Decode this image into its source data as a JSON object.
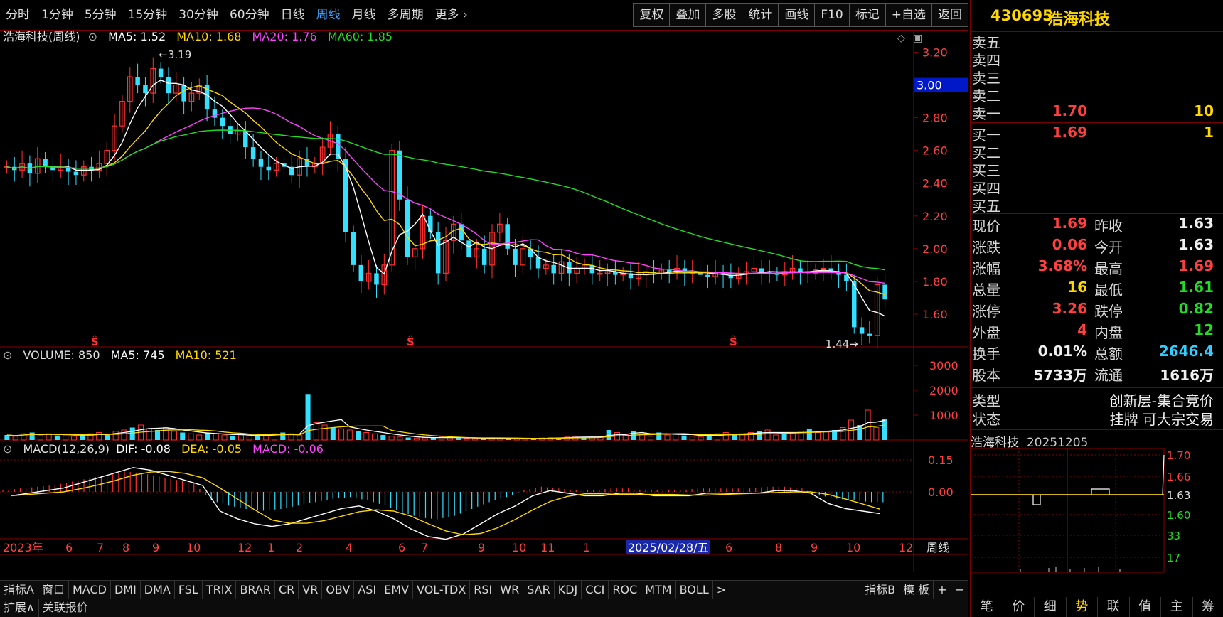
{
  "top_tabs": [
    "分时",
    "1分钟",
    "5分钟",
    "15分钟",
    "30分钟",
    "60分钟",
    "日线",
    "周线",
    "月线",
    "多周期",
    "更多 ›"
  ],
  "active_tab": "周线",
  "tools": [
    "复权",
    "叠加",
    "多股",
    "统计",
    "画线",
    "F10",
    "标记",
    "+自选",
    "返回"
  ],
  "main_legend": {
    "title": "浩海科技(周线)",
    "ma5": "MA5: 1.52",
    "ma10": "MA10: 1.68",
    "ma20": "MA20: 1.76",
    "ma60": "MA60: 1.85"
  },
  "price_axis": [
    "3.20",
    "3.00",
    "2.80",
    "2.60",
    "2.40",
    "2.20",
    "2.00",
    "1.80",
    "1.60"
  ],
  "current_price_tag": "3.00",
  "high_mark": "3.19",
  "low_mark": "1.44",
  "vol_legend": {
    "vol": "VOLUME: 850",
    "ma5": "MA5: 745",
    "ma10": "MA10: 521"
  },
  "vol_axis": [
    "3000",
    "2000",
    "1000"
  ],
  "macd_legend": {
    "title": "MACD(12,26,9)",
    "dif": "DIF: -0.08",
    "dea": "DEA: -0.05",
    "macd": "MACD: -0.06"
  },
  "macd_axis": [
    "0.15",
    "0.00"
  ],
  "time_axis": [
    {
      "label": "2023年",
      "x": 0
    },
    {
      "label": "6",
      "x": 88
    },
    {
      "label": "7",
      "x": 132
    },
    {
      "label": "8",
      "x": 168
    },
    {
      "label": "9",
      "x": 210
    },
    {
      "label": "10",
      "x": 258
    },
    {
      "label": "12",
      "x": 330
    },
    {
      "label": "1",
      "x": 372
    },
    {
      "label": "2",
      "x": 412
    },
    {
      "label": "4",
      "x": 482
    },
    {
      "label": "6",
      "x": 556
    },
    {
      "label": "7",
      "x": 588
    },
    {
      "label": "9",
      "x": 668
    },
    {
      "label": "10",
      "x": 716
    },
    {
      "label": "11",
      "x": 756
    },
    {
      "label": "1",
      "x": 816
    },
    {
      "label": "6",
      "x": 1016
    },
    {
      "label": "8",
      "x": 1086
    },
    {
      "label": "9",
      "x": 1136
    },
    {
      "label": "10",
      "x": 1186
    },
    {
      "label": "12",
      "x": 1260
    }
  ],
  "cursor_date": "2025/02/28/五",
  "period_label": "周线",
  "bottom_tabs": [
    "指标A",
    "窗口",
    "MACD",
    "DMI",
    "DMA",
    "FSL",
    "TRIX",
    "BRAR",
    "CR",
    "VR",
    "OBV",
    "ASI",
    "EMV",
    "VOL-TDX",
    "RSI",
    "WR",
    "SAR",
    "KDJ",
    "CCI",
    "ROC",
    "MTM",
    "BOLL",
    ">"
  ],
  "bottom_right": [
    "指标B",
    "模 板",
    "+",
    "−"
  ],
  "bottom_bar2": [
    "扩展∧",
    "关联报价"
  ],
  "stock": {
    "code": "430695",
    "name": "浩海科技"
  },
  "sell": [
    {
      "label": "卖五",
      "price": "",
      "vol": ""
    },
    {
      "label": "卖四",
      "price": "",
      "vol": ""
    },
    {
      "label": "卖三",
      "price": "",
      "vol": ""
    },
    {
      "label": "卖二",
      "price": "",
      "vol": ""
    },
    {
      "label": "卖一",
      "price": "1.70",
      "vol": "10"
    }
  ],
  "buy": [
    {
      "label": "买一",
      "price": "1.69",
      "vol": "1"
    },
    {
      "label": "买二",
      "price": "",
      "vol": ""
    },
    {
      "label": "买三",
      "price": "",
      "vol": ""
    },
    {
      "label": "买四",
      "price": "",
      "vol": ""
    },
    {
      "label": "买五",
      "price": "",
      "vol": ""
    }
  ],
  "quote": [
    {
      "l1": "现价",
      "v1": "1.69",
      "c1": "red",
      "l2": "昨收",
      "v2": "1.63",
      "c2": "white"
    },
    {
      "l1": "涨跌",
      "v1": "0.06",
      "c1": "red",
      "l2": "今开",
      "v2": "1.63",
      "c2": "white"
    },
    {
      "l1": "涨幅",
      "v1": "3.68%",
      "c1": "red",
      "l2": "最高",
      "v2": "1.69",
      "c2": "red"
    },
    {
      "l1": "总量",
      "v1": "16",
      "c1": "yellow",
      "l2": "最低",
      "v2": "1.61",
      "c2": "green"
    },
    {
      "l1": "涨停",
      "v1": "3.26",
      "c1": "red",
      "l2": "跌停",
      "v2": "0.82",
      "c2": "green"
    },
    {
      "l1": "外盘",
      "v1": "4",
      "c1": "red",
      "l2": "内盘",
      "v2": "12",
      "c2": "green"
    },
    {
      "l1": "换手",
      "v1": "0.01%",
      "c1": "white",
      "l2": "总额",
      "v2": "2646.4",
      "c2": "cyan"
    },
    {
      "l1": "股本",
      "v1": "5733万",
      "c1": "white",
      "l2": "流通",
      "v2": "1616万",
      "c2": "white"
    }
  ],
  "type_label": "类型",
  "type_value": "创新层-集合竞价",
  "status_label": "状态",
  "status_value": "挂牌 可大宗交易",
  "mini": {
    "name": "浩海科技",
    "date": "20251205",
    "axis": [
      "1.70",
      "1.66",
      "1.63",
      "1.60",
      "33",
      "17"
    ]
  },
  "right_tabs": [
    "笔",
    "价",
    "细",
    "势",
    "联",
    "值",
    "主",
    "筹"
  ],
  "active_right_tab": "势",
  "chart_data": {
    "type": "candlestick",
    "title": "浩海科技(周线)",
    "ylim": [
      1.4,
      3.25
    ],
    "close": [
      2.5,
      2.48,
      2.52,
      2.46,
      2.55,
      2.5,
      2.48,
      2.5,
      2.47,
      2.45,
      2.5,
      2.48,
      2.52,
      2.6,
      2.75,
      2.9,
      3.05,
      3.0,
      2.95,
      3.1,
      3.05,
      2.95,
      3.0,
      2.9,
      2.95,
      3.0,
      2.85,
      2.8,
      2.75,
      2.7,
      2.72,
      2.62,
      2.55,
      2.5,
      2.48,
      2.52,
      2.5,
      2.45,
      2.55,
      2.5,
      2.52,
      2.62,
      2.7,
      2.55,
      2.1,
      1.9,
      1.8,
      1.85,
      1.78,
      1.9,
      2.6,
      2.3,
      1.95,
      2.0,
      2.2,
      2.1,
      1.85,
      2.05,
      2.15,
      2.05,
      1.95,
      2.0,
      1.9,
      2.1,
      2.15,
      2.0,
      1.9,
      2.0,
      1.95,
      1.88,
      1.9,
      1.85,
      1.92,
      1.85,
      1.88,
      1.9,
      1.85,
      1.85,
      1.86,
      1.84,
      1.85,
      1.82,
      1.84,
      1.86,
      1.85,
      1.87,
      1.86,
      1.88,
      1.85,
      1.86,
      1.84,
      1.83,
      1.85,
      1.84,
      1.82,
      1.85,
      1.86,
      1.88,
      1.86,
      1.85,
      1.84,
      1.86,
      1.88,
      1.86,
      1.85,
      1.87,
      1.88,
      1.86,
      1.84,
      1.8,
      1.52,
      1.48,
      1.47,
      1.78,
      1.69
    ],
    "volume": [
      200,
      150,
      250,
      300,
      200,
      250,
      180,
      200,
      150,
      200,
      250,
      300,
      200,
      350,
      400,
      500,
      600,
      450,
      400,
      500,
      350,
      300,
      250,
      200,
      300,
      250,
      200,
      150,
      200,
      180,
      150,
      200,
      250,
      300,
      250,
      200,
      1850,
      700,
      600,
      500,
      450,
      400,
      350,
      300,
      250,
      200,
      150,
      120,
      100,
      80,
      90,
      100,
      120,
      90,
      80,
      70,
      60,
      80,
      90,
      70,
      60,
      50,
      60,
      70,
      80,
      90,
      100,
      120,
      150,
      130,
      100,
      120,
      400,
      300,
      200,
      350,
      250,
      150,
      300,
      200,
      250,
      180,
      150,
      120,
      200,
      250,
      300,
      200,
      250,
      300,
      350,
      400,
      200,
      250,
      300,
      350,
      450,
      300,
      350,
      400,
      500,
      800,
      600,
      1200,
      500,
      850
    ],
    "vol_ylim": [
      0,
      3400
    ],
    "macd": [
      0.01,
      0.02,
      0.03,
      0.04,
      0.06,
      0.08,
      0.1,
      0.12,
      0.11,
      0.09,
      0.07,
      0.05,
      -0.05,
      -0.08,
      -0.1,
      -0.11,
      -0.1,
      -0.08,
      -0.06,
      -0.04,
      -0.03,
      -0.05,
      -0.08,
      -0.12,
      -0.15,
      -0.16,
      -0.14,
      -0.1,
      -0.06,
      -0.03,
      0.01,
      0.03,
      0.02,
      0.01,
      0.01,
      0.02,
      0.02,
      0.01,
      0.01,
      0.01,
      0.02,
      0.02,
      0.02,
      0.02,
      0.03,
      0.03,
      0.02,
      -0.02,
      -0.04,
      -0.05,
      -0.06
    ],
    "macd_ylim": [
      -0.22,
      0.2
    ]
  }
}
